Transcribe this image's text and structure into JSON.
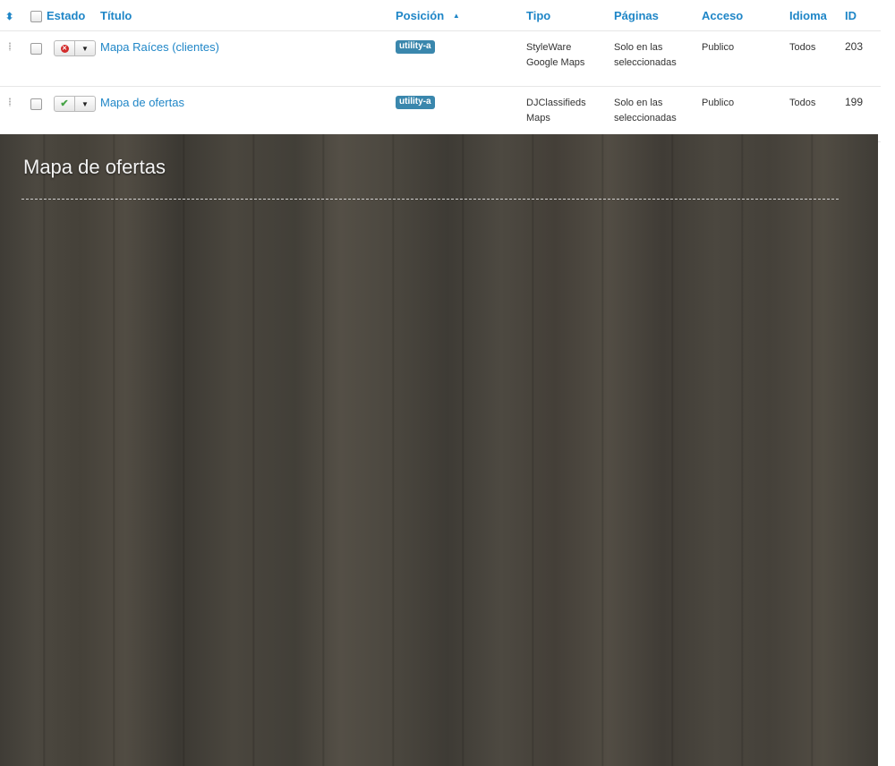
{
  "table": {
    "headers": {
      "sort_icon": "⬍",
      "estado": "Estado",
      "titulo": "Título",
      "posicion": "Posición",
      "posicion_sort": "▲",
      "tipo": "Tipo",
      "paginas": "Páginas",
      "acceso": "Acceso",
      "idioma": "Idioma",
      "id": "ID"
    },
    "rows": [
      {
        "status": "unpublished",
        "status_icon": "x-circle-icon",
        "title": "Mapa Raíces (clientes)",
        "position": "utility-a",
        "type_line1": "StyleWare",
        "type_line2": "Google Maps",
        "pages_line1": "Solo en las",
        "pages_line2": "seleccionadas",
        "access": "Publico",
        "language": "Todos",
        "id": "203"
      },
      {
        "status": "published",
        "status_icon": "check-icon",
        "title": "Mapa de ofertas",
        "position": "utility-a",
        "type_line1": "DJClassifieds",
        "type_line2": "Maps",
        "pages_line1": "Solo en las",
        "pages_line2": "seleccionadas",
        "access": "Publico",
        "language": "Todos",
        "id": "199"
      }
    ]
  },
  "preview": {
    "title": "Mapa de ofertas"
  },
  "colors": {
    "link": "#1f86c7",
    "badge": "#3a87ad",
    "unpublished": "#d22b2b",
    "published": "#47a447",
    "preview_bg": "#4a463f"
  }
}
